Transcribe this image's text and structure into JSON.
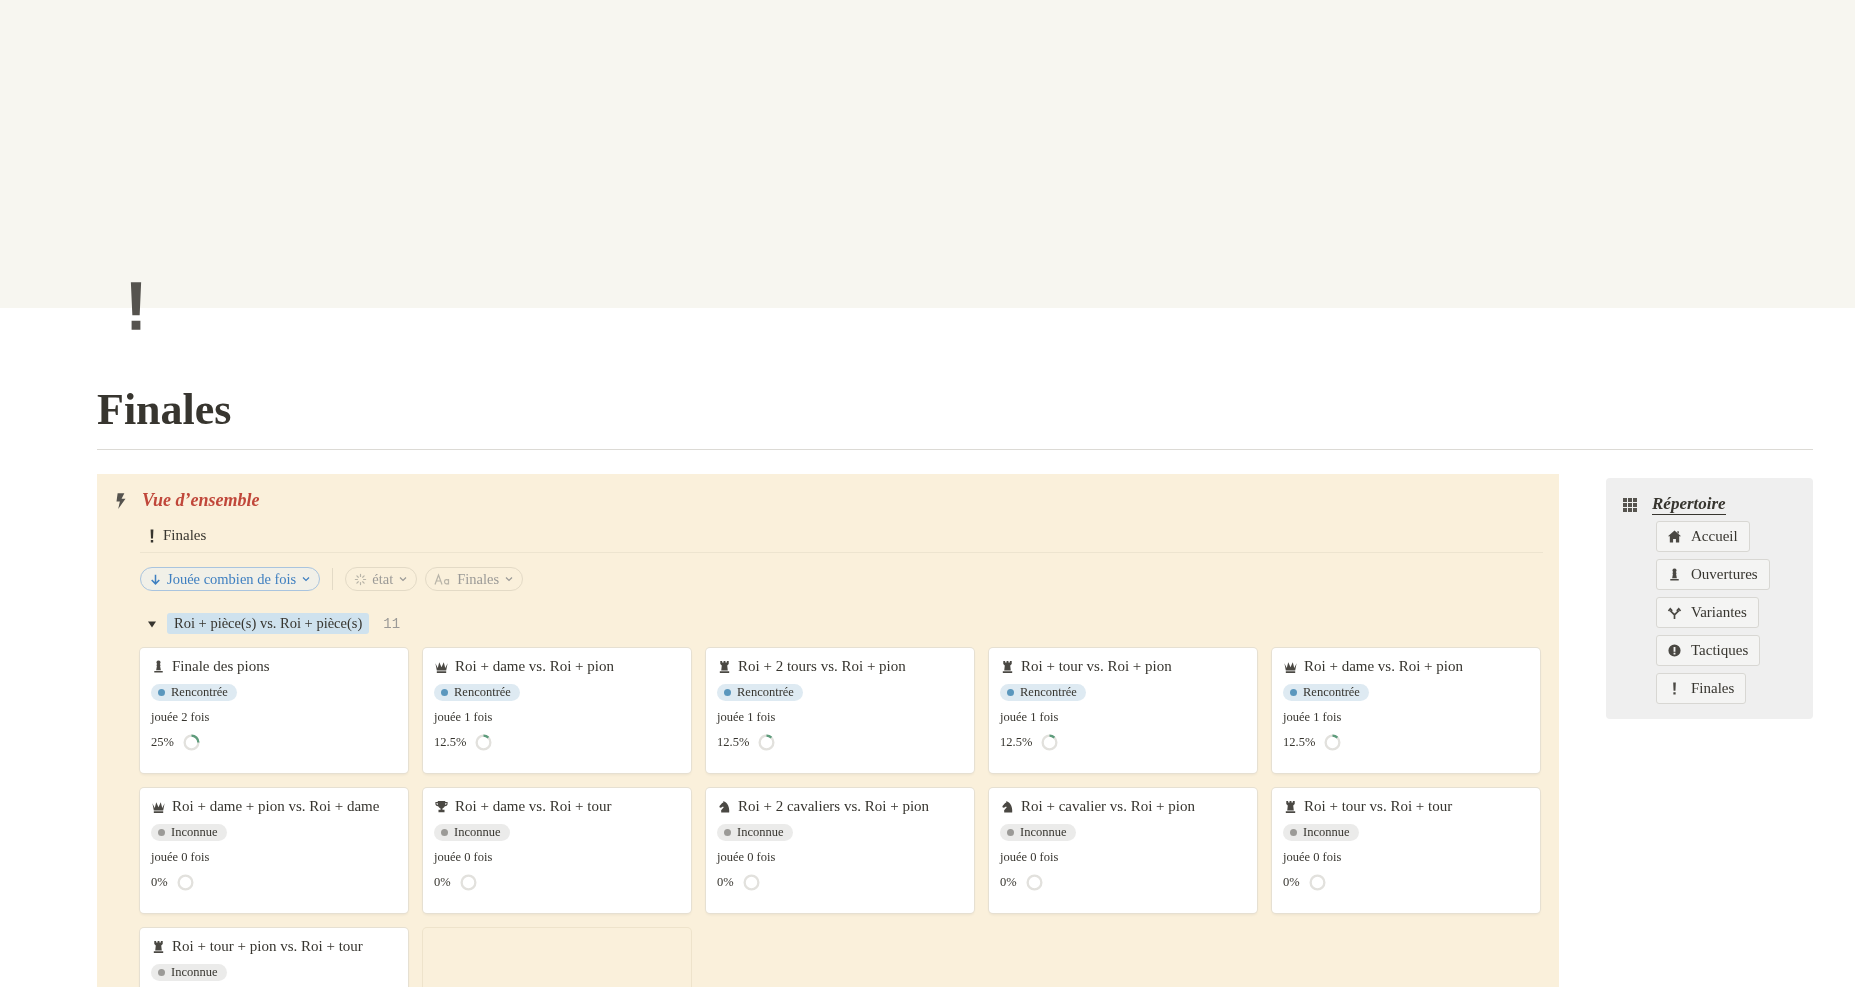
{
  "page": {
    "title": "Finales"
  },
  "overview": {
    "title": "Vue d’ensemble",
    "view_tab": "Finales",
    "sort": "Jouée combien de fois",
    "filters": [
      {
        "label": "état",
        "kind": "status"
      },
      {
        "label": "Finales",
        "kind": "text"
      }
    ],
    "group": {
      "label": "Roi + pièce(s) vs. Roi + pièce(s)",
      "count": "11",
      "expanded": true
    },
    "cards": [
      {
        "kind": "pawn",
        "title": "Finale des pions",
        "status": "Rencontrée",
        "color": "#5b97bd",
        "played": "jouée 2 fois",
        "percent": "25%"
      },
      {
        "kind": "queen",
        "title": "Roi + dame vs. Roi + pion",
        "status": "Rencontrée",
        "color": "#5b97bd",
        "played": "jouée 1 fois",
        "percent": "12.5%"
      },
      {
        "kind": "rook",
        "title": "Roi + 2 tours vs. Roi + pion",
        "status": "Rencontrée",
        "color": "#5b97bd",
        "played": "jouée 1 fois",
        "percent": "12.5%"
      },
      {
        "kind": "rook",
        "title": "Roi + tour vs. Roi + pion",
        "status": "Rencontrée",
        "color": "#5b97bd",
        "played": "jouée 1 fois",
        "percent": "12.5%"
      },
      {
        "kind": "queen",
        "title": "Roi + dame vs. Roi + pion",
        "status": "Rencontrée",
        "color": "#5b97bd",
        "played": "jouée 1 fois",
        "percent": "12.5%"
      },
      {
        "kind": "queen",
        "title": "Roi + dame + pion vs. Roi + dame",
        "status": "Inconnue",
        "color": "#9b9a97",
        "played": "jouée 0 fois",
        "percent": "0%"
      },
      {
        "kind": "trophy",
        "title": "Roi + dame vs. Roi + tour",
        "status": "Inconnue",
        "color": "#9b9a97",
        "played": "jouée 0 fois",
        "percent": "0%"
      },
      {
        "kind": "knight",
        "title": "Roi + 2 cavaliers vs. Roi + pion",
        "status": "Inconnue",
        "color": "#9b9a97",
        "played": "jouée 0 fois",
        "percent": "0%"
      },
      {
        "kind": "knight",
        "title": "Roi + cavalier vs. Roi + pion",
        "status": "Inconnue",
        "color": "#9b9a97",
        "played": "jouée 0 fois",
        "percent": "0%"
      },
      {
        "kind": "rook",
        "title": "Roi + tour vs. Roi + tour",
        "status": "Inconnue",
        "color": "#9b9a97",
        "played": "jouée 0 fois",
        "percent": "0%"
      },
      {
        "kind": "rook",
        "title": "Roi + tour + pion vs. Roi + tour",
        "status": "Inconnue",
        "color": "#9b9a97"
      },
      {
        "kind": "empty"
      }
    ]
  },
  "sidebar": {
    "title": "Répertoire",
    "links": [
      {
        "label": "Accueil",
        "kind": "house"
      },
      {
        "label": "Ouvertures",
        "kind": "pawn"
      },
      {
        "label": "Variantes",
        "kind": "fork"
      },
      {
        "label": "Tactiques",
        "kind": "alert"
      },
      {
        "label": "Finales",
        "kind": "exclamation"
      }
    ]
  }
}
